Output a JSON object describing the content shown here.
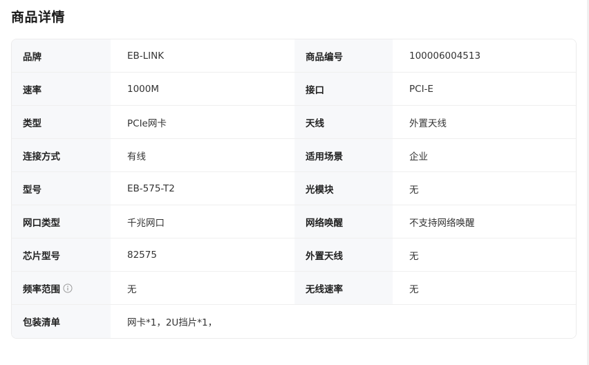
{
  "section_title": "商品详情",
  "rows": [
    {
      "label1": "品牌",
      "value1": "EB-LINK",
      "label2": "商品编号",
      "value2": "100006004513"
    },
    {
      "label1": "速率",
      "value1": "1000M",
      "label2": "接口",
      "value2": "PCI-E"
    },
    {
      "label1": "类型",
      "value1": "PCIe网卡",
      "label2": "天线",
      "value2": "外置天线"
    },
    {
      "label1": "连接方式",
      "value1": "有线",
      "label2": "适用场景",
      "value2": "企业"
    },
    {
      "label1": "型号",
      "value1": "EB-575-T2",
      "label2": "光模块",
      "value2": "无"
    },
    {
      "label1": "网口类型",
      "value1": "千兆网口",
      "label2": "网络唤醒",
      "value2": "不支持网络唤醒"
    },
    {
      "label1": "芯片型号",
      "value1": "82575",
      "label2": "外置天线",
      "value2": "无"
    },
    {
      "label1": "频率范围",
      "value1": "无",
      "label2": "无线速率",
      "value2": "无"
    }
  ],
  "package": {
    "label": "包装清单",
    "value": "网卡*1，2U挡片*1，"
  },
  "icons": {
    "info": "info-circle-icon"
  }
}
